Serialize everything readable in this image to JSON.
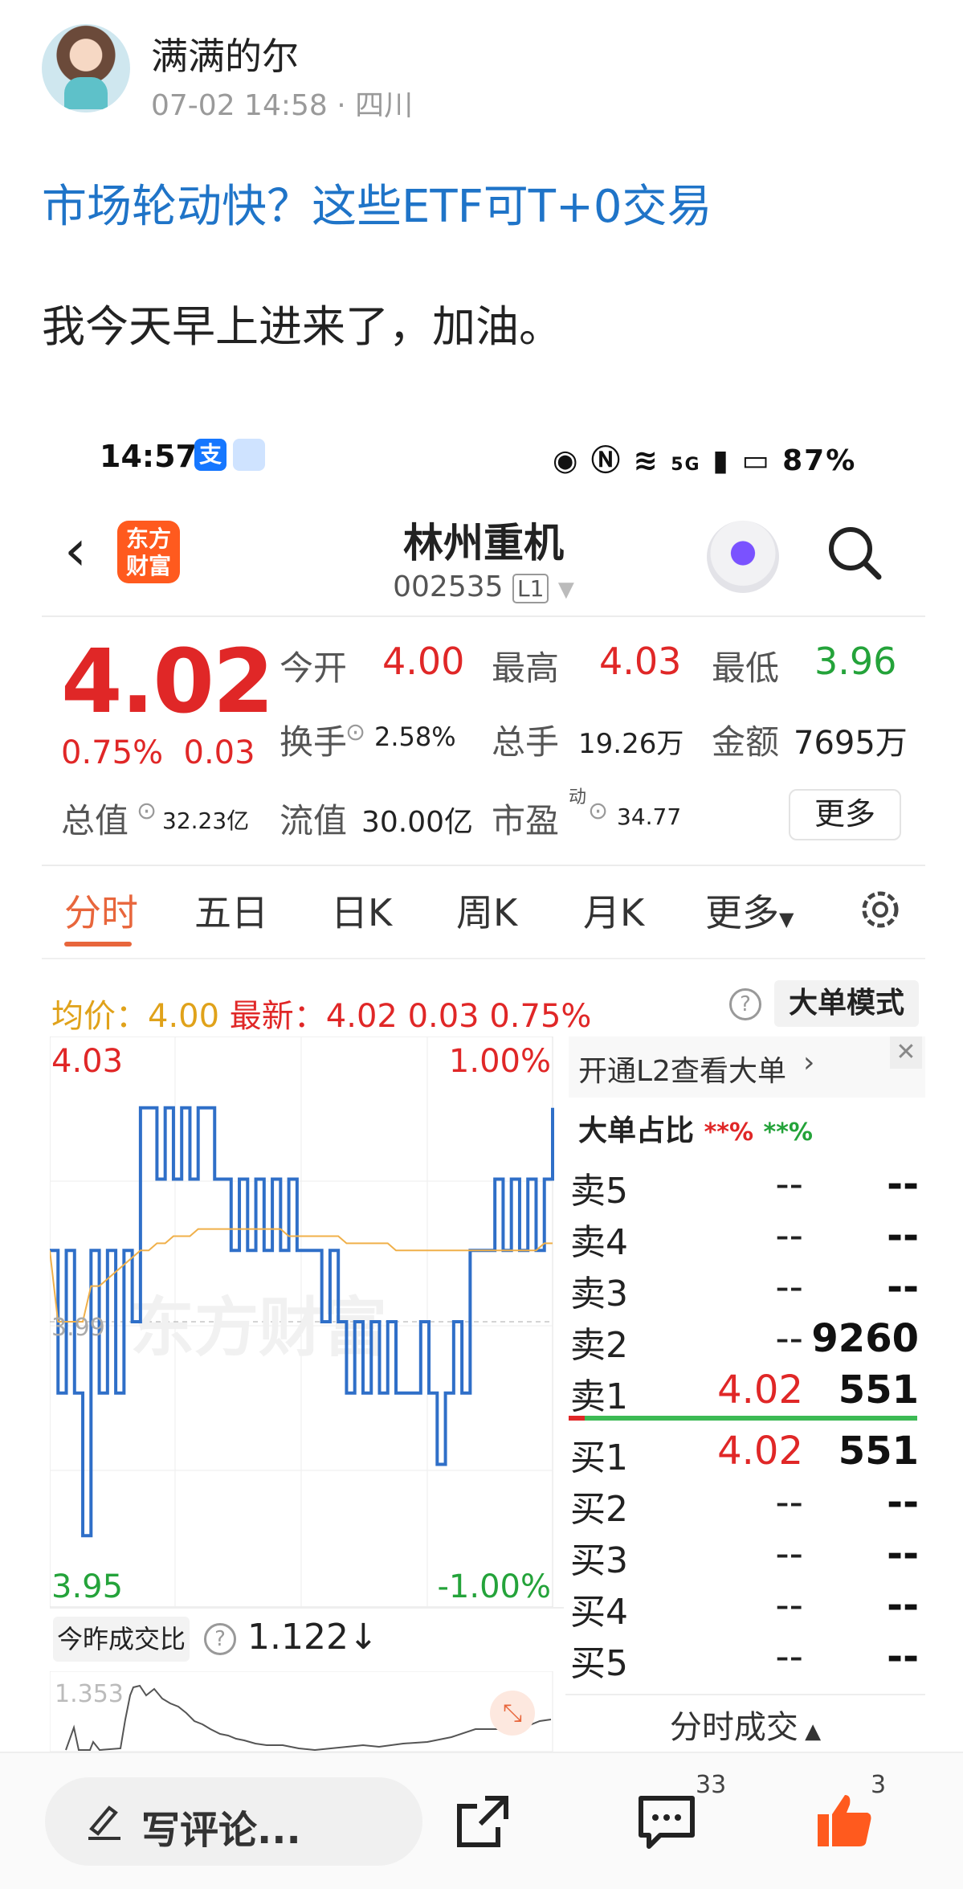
{
  "post": {
    "author": "满满的尔",
    "meta": "07-02 14:58 · 四川",
    "title_link": "市场轮动快？这些ETF可T+0交易",
    "body": "我今天早上进来了，加油。"
  },
  "screenshot": {
    "status": {
      "time": "14:57",
      "alipay_glyph": "支",
      "battery": "87%",
      "net": "5G"
    },
    "header": {
      "name": "林州重机",
      "code": "002535",
      "level": "L1",
      "logo_line1": "东方",
      "logo_line2": "财富"
    },
    "quote": {
      "price": "4.02",
      "change_pct": "0.75%",
      "change": "0.03",
      "open_label": "今开",
      "open": "4.00",
      "high_label": "最高",
      "high": "4.03",
      "low_label": "最低",
      "low": "3.96",
      "turnover_label": "换手",
      "turnover": "2.58%",
      "volume_label": "总手",
      "volume": "19.26万",
      "amount_label": "金额",
      "amount": "7695万",
      "mktcap_label": "总值",
      "mktcap": "32.23亿",
      "float_label": "流值",
      "float": "30.00亿",
      "pe_label": "市盈",
      "pe_sup": "动",
      "pe": "34.77",
      "more": "更多"
    },
    "tabs": [
      "分时",
      "五日",
      "日K",
      "周K",
      "月K",
      "更多"
    ],
    "avg_bar": {
      "avg_label": "均价：",
      "avg": "4.00",
      "latest_label": "最新：",
      "latest": "4.02",
      "chg": "0.03",
      "pct": "0.75%",
      "help": "?",
      "mode": "大单模式"
    },
    "chart_labels": {
      "top_price": "4.03",
      "top_pct": "1.00%",
      "bottom_price": "3.95",
      "bottom_pct": "-1.00%",
      "mid_price": "3.99",
      "watermark": "东方财富"
    },
    "volume_panel": {
      "selector": "今昨成交比",
      "help": "?",
      "value": "1.122↓",
      "y_label": "1.353"
    },
    "orderbook": {
      "l2": "开通L2查看大单",
      "ratio_label": "大单占比",
      "ratio_red": "**%",
      "ratio_green": "**%",
      "close_glyph": "✕",
      "asks": [
        {
          "label": "卖5",
          "price": "--",
          "vol": "--"
        },
        {
          "label": "卖4",
          "price": "--",
          "vol": "--"
        },
        {
          "label": "卖3",
          "price": "--",
          "vol": "--"
        },
        {
          "label": "卖2",
          "price": "--",
          "vol": "9260"
        },
        {
          "label": "卖1",
          "price": "4.02",
          "vol": "551"
        }
      ],
      "bids": [
        {
          "label": "买1",
          "price": "4.02",
          "vol": "551"
        },
        {
          "label": "买2",
          "price": "--",
          "vol": "--"
        },
        {
          "label": "买3",
          "price": "--",
          "vol": "--"
        },
        {
          "label": "买4",
          "price": "--",
          "vol": "--"
        },
        {
          "label": "买5",
          "price": "--",
          "vol": "--"
        }
      ],
      "footer": "分时成交"
    }
  },
  "bottom": {
    "comment_placeholder": "写评论...",
    "comments": "33",
    "likes": "3"
  },
  "chart_data": {
    "type": "line",
    "ylim": [
      3.95,
      4.03
    ],
    "series": [
      {
        "values": [
          4.0,
          3.98,
          4.0,
          3.98,
          3.96,
          4.0,
          3.98,
          4.0,
          3.98,
          4.0,
          3.99,
          4.02,
          4.02,
          4.01,
          4.02,
          4.01,
          4.02,
          4.01,
          4.02,
          4.02,
          4.01,
          4.01,
          4.0,
          4.01,
          4.0,
          4.01,
          4.0,
          4.01,
          4.0,
          4.01,
          4.0,
          4.0,
          4.0,
          3.99,
          4.0,
          3.99,
          3.98,
          3.99,
          3.98,
          3.99,
          3.98,
          3.99,
          3.98,
          3.98,
          3.98,
          3.99,
          3.98,
          3.97,
          3.98,
          3.99,
          3.98,
          4.0,
          4.0,
          4.0,
          4.01,
          4.0,
          4.01,
          4.0,
          4.01,
          4.0,
          4.01,
          4.02
        ]
      },
      {
        "values": [
          4.0,
          3.99,
          3.99,
          3.99,
          3.99,
          3.995,
          3.995,
          3.996,
          3.997,
          3.998,
          3.999,
          4.0,
          4.0,
          4.001,
          4.001,
          4.002,
          4.002,
          4.002,
          4.003,
          4.003,
          4.003,
          4.003,
          4.003,
          4.003,
          4.003,
          4.003,
          4.003,
          4.003,
          4.003,
          4.002,
          4.002,
          4.002,
          4.002,
          4.002,
          4.002,
          4.002,
          4.001,
          4.001,
          4.001,
          4.001,
          4.001,
          4.001,
          4.0,
          4.0,
          4.0,
          4.0,
          4.0,
          4.0,
          4.0,
          4.0,
          4.0,
          4.0,
          4.0,
          4.0,
          4.0,
          4.0,
          4.0,
          4.0,
          4.0,
          4.0,
          4.001,
          4.001
        ]
      }
    ]
  }
}
